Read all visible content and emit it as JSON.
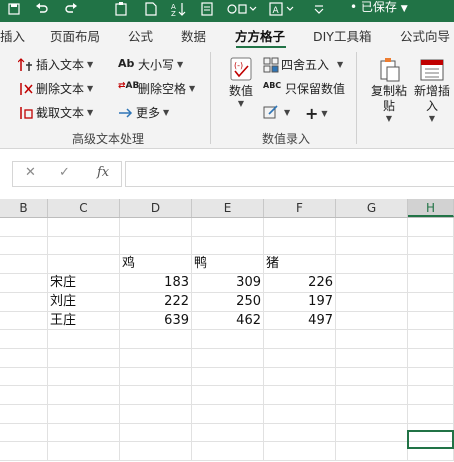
{
  "titlebar": {
    "status": "已保存",
    "status_prefix": "•"
  },
  "tabs": [
    {
      "label": "插入"
    },
    {
      "label": "页面布局"
    },
    {
      "label": "公式"
    },
    {
      "label": "数据"
    },
    {
      "label": "方方格子",
      "active": true
    },
    {
      "label": "DIY工具箱"
    },
    {
      "label": "公式向导"
    }
  ],
  "ribbon": {
    "text_group": {
      "insert_text": "插入文本",
      "delete_text": "删除文本",
      "extract_text": "截取文本",
      "case": "大小写",
      "case_icon": "Ab",
      "delete_space": "删除空格",
      "delete_space_icon": "AB",
      "more": "更多",
      "label": "高级文本处理"
    },
    "number_group": {
      "value": "数值",
      "round": "四舍五入",
      "keep_value": "只保留数值",
      "keep_value_icon": "ABC",
      "label": "数值录入",
      "plus": "+"
    },
    "copy_paste": "复制粘贴",
    "add_insert": "新增插入"
  },
  "formula_bar": {
    "cancel": "✕",
    "enter": "✓",
    "fx": "fx",
    "value": ""
  },
  "columns": [
    "B",
    "C",
    "D",
    "E",
    "F",
    "G",
    "H"
  ],
  "table": {
    "headers": [
      "鸡",
      "鸭",
      "猪"
    ],
    "rows": [
      {
        "name": "宋庄",
        "values": [
          "183",
          "309",
          "226"
        ]
      },
      {
        "name": "刘庄",
        "values": [
          "222",
          "250",
          "197"
        ]
      },
      {
        "name": "王庄",
        "values": [
          "639",
          "462",
          "497"
        ]
      }
    ]
  },
  "colors": {
    "brand": "#217346",
    "grid_line": "#e1e1e1",
    "header_bg": "#e6e6e6"
  }
}
